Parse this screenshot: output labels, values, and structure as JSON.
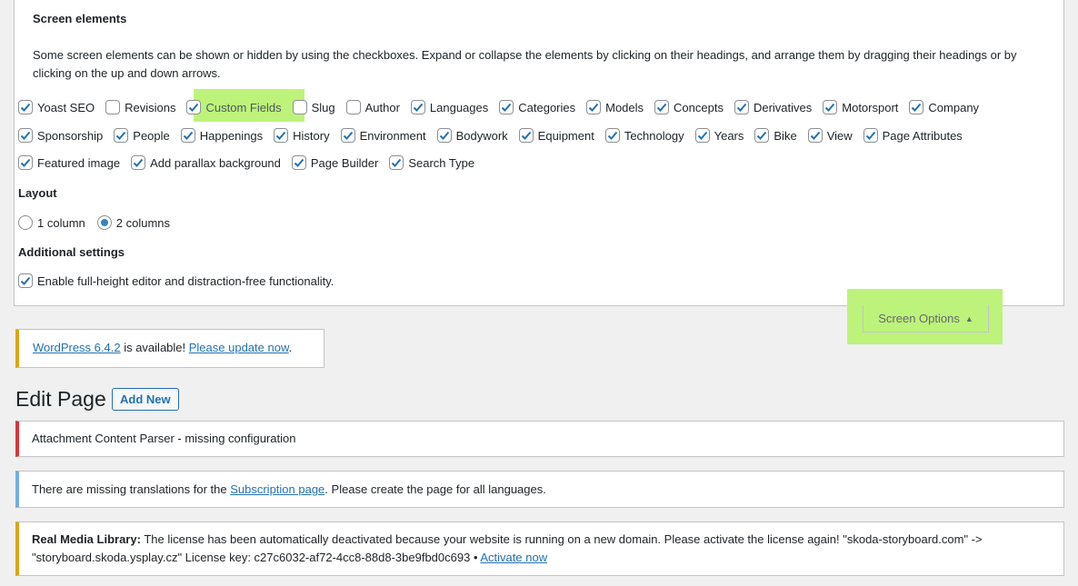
{
  "screen_elements": {
    "heading": "Screen elements",
    "description": "Some screen elements can be shown or hidden by using the checkboxes. Expand or collapse the elements by clicking on their headings, and arrange them by dragging their headings or by clicking on the up and down arrows.",
    "row1": [
      {
        "label": "Yoast SEO",
        "checked": true
      },
      {
        "label": "Revisions",
        "checked": false
      },
      {
        "label": "Custom Fields",
        "checked": true
      },
      {
        "label": "Slug",
        "checked": false
      },
      {
        "label": "Author",
        "checked": false
      },
      {
        "label": "Languages",
        "checked": true
      },
      {
        "label": "Categories",
        "checked": true
      },
      {
        "label": "Models",
        "checked": true
      },
      {
        "label": "Concepts",
        "checked": true
      },
      {
        "label": "Derivatives",
        "checked": true
      },
      {
        "label": "Motorsport",
        "checked": true
      },
      {
        "label": "Company",
        "checked": true
      }
    ],
    "row2": [
      {
        "label": "Sponsorship",
        "checked": true
      },
      {
        "label": "People",
        "checked": true
      },
      {
        "label": "Happenings",
        "checked": true
      },
      {
        "label": "History",
        "checked": true
      },
      {
        "label": "Environment",
        "checked": true
      },
      {
        "label": "Bodywork",
        "checked": true
      },
      {
        "label": "Equipment",
        "checked": true
      },
      {
        "label": "Technology",
        "checked": true
      },
      {
        "label": "Years",
        "checked": true
      },
      {
        "label": "Bike",
        "checked": true
      },
      {
        "label": "View",
        "checked": true
      },
      {
        "label": "Page Attributes",
        "checked": true
      }
    ],
    "row3": [
      {
        "label": "Featured image",
        "checked": true
      },
      {
        "label": "Add parallax background",
        "checked": true
      },
      {
        "label": "Page Builder",
        "checked": true
      },
      {
        "label": "Search Type",
        "checked": true
      }
    ]
  },
  "layout": {
    "heading": "Layout",
    "option1": "1 column",
    "option2": "2 columns",
    "selected": 2
  },
  "additional": {
    "heading": "Additional settings",
    "option": "Enable full-height editor and distraction-free functionality."
  },
  "screen_options": {
    "label": "Screen Options",
    "arrow": "▲"
  },
  "update_notice": {
    "link1": "WordPress 6.4.2",
    "text": " is available! ",
    "link2": "Please update now",
    "end": "."
  },
  "page": {
    "title": "Edit Page",
    "add_new": "Add New"
  },
  "notice_parser": {
    "text": "Attachment Content Parser - missing configuration"
  },
  "notice_translations": {
    "before": "There are missing translations for the ",
    "link": "Subscription page",
    "after": ". Please create the page for all languages."
  },
  "notice_rml": {
    "strong": "Real Media Library:",
    "text": " The license has been automatically deactivated because your website is running on a new domain. Please activate the license again! \"skoda-storyboard.com\" -> \"storyboard.skoda.ysplay.cz\" License key: c27c6032-af72-4cc8-88d8-3be9fbd0c693 • ",
    "link": "Activate now"
  },
  "colors": {
    "highlight": "#bdf37a",
    "accent": "#2271b1",
    "warning": "#dba617",
    "error": "#d63638",
    "info": "#72aee6"
  }
}
